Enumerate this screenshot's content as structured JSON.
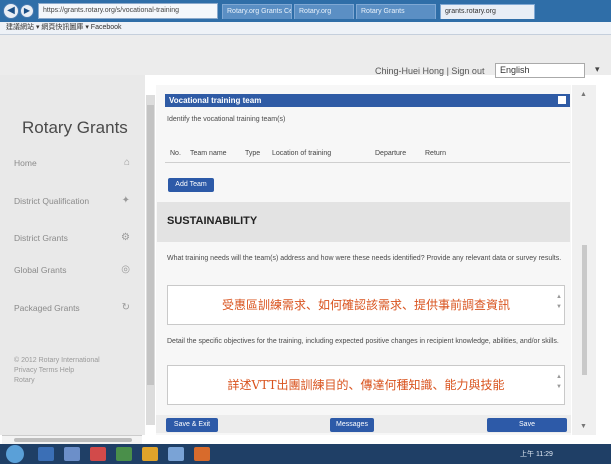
{
  "browser": {
    "address": "https://grants.rotary.org/s/vocational-training",
    "tabs": [
      "Rotary.org Grants Center",
      "Rotary.org",
      "Rotary Grants",
      "grants.rotary.org"
    ],
    "bookmarks": "建議網站 ▾   網頁快訊圖庫 ▾   Facebook"
  },
  "header": {
    "user_name": "Ching-Huei Hong",
    "separator": "|",
    "signout": "Sign out",
    "language": "English"
  },
  "sidebar": {
    "brand": "Rotary Grants",
    "items": [
      {
        "label": "Home",
        "icon": "home-icon",
        "glyph": "⌂"
      },
      {
        "label": "District Qualification",
        "icon": "ribbon-icon",
        "glyph": "✦"
      },
      {
        "label": "District Grants",
        "icon": "gear-icon",
        "glyph": "⚙"
      },
      {
        "label": "Global Grants",
        "icon": "globe-icon",
        "glyph": "◎"
      },
      {
        "label": "Packaged Grants",
        "icon": "refresh-icon",
        "glyph": "↻"
      }
    ],
    "footer": "© 2012 Rotary International",
    "footer_links": "Privacy  Terms  Help",
    "footer_extra": "Rotary"
  },
  "main": {
    "section_title": "Vocational training team",
    "identify_text": "Identify the vocational training team(s)",
    "table_headers": [
      "No.",
      "Team name",
      "Type",
      "Location of training",
      "Departure",
      "Return"
    ],
    "add_team_label": "Add Team",
    "sustainability_title": "SUSTAINABILITY",
    "q1_text": "What training needs will the team(s) address and how were these needs identified? Provide any relevant data or survey results.",
    "q1_answer": "受惠區訓練需求、如何確認該需求、提供事前調查資訊",
    "q2_text": "Detail the specific objectives for the training, including expected positive changes in recipient knowledge, abilities, and/or skills.",
    "q2_answer": "詳述VTT出團訓練目的、傳達何種知識、能力與技能",
    "save_exit_label": "Save & Exit",
    "messages_label": "Messages",
    "save_label": "Save"
  },
  "taskbar": {
    "clock": "上午 11:29"
  }
}
